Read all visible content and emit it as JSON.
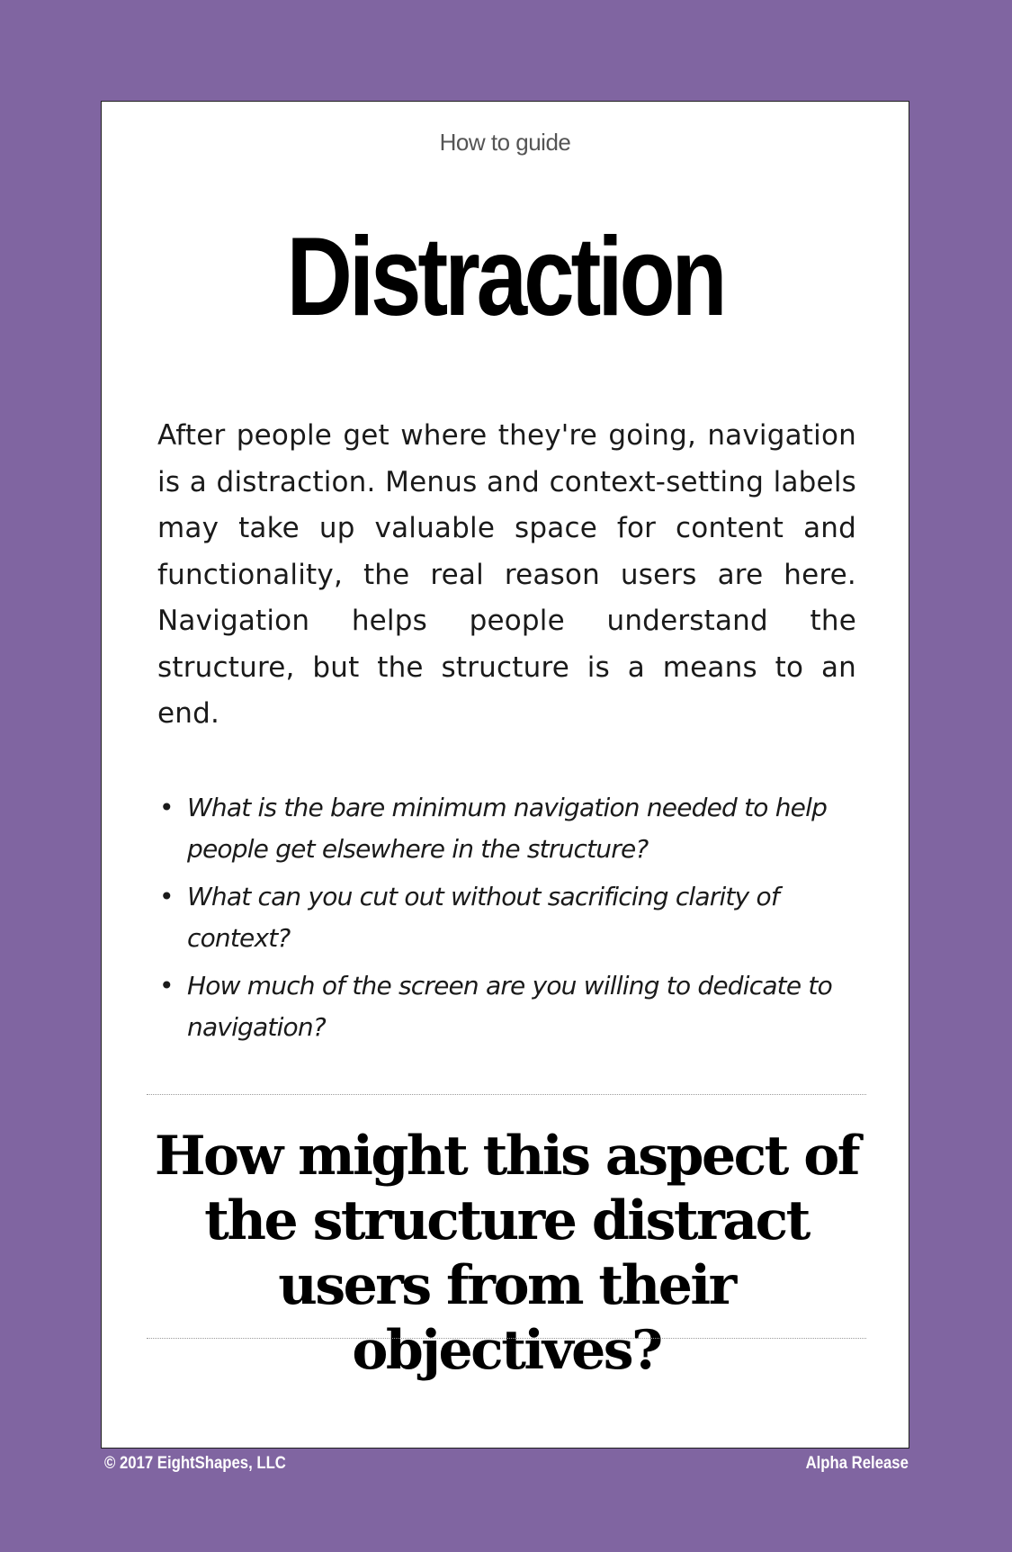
{
  "colors": {
    "background": "#8065a1",
    "card": "#ffffff",
    "text": "#000000",
    "kicker": "#555555",
    "footer_text": "#ffffff"
  },
  "card": {
    "kicker": "How to guide",
    "title": "Distraction",
    "body": "After people get where they're going, navigation is a distraction. Menus and context-setting labels may take up valuable space for content and functionality, the real reason users are here. Navigation helps people understand the structure, but the structure is a means to an end.",
    "questions": [
      "What is the bare minimum navigation needed to help people get elsewhere in the structure?",
      "What can you cut out without sacrificing clarity of context?",
      "How much of the screen are you willing to dedicate to navigation?"
    ],
    "prompt": "How might this aspect of the structure distract users from their objectives?"
  },
  "footer": {
    "copyright": "© 2017 EightShapes, LLC",
    "release": "Alpha Release"
  }
}
